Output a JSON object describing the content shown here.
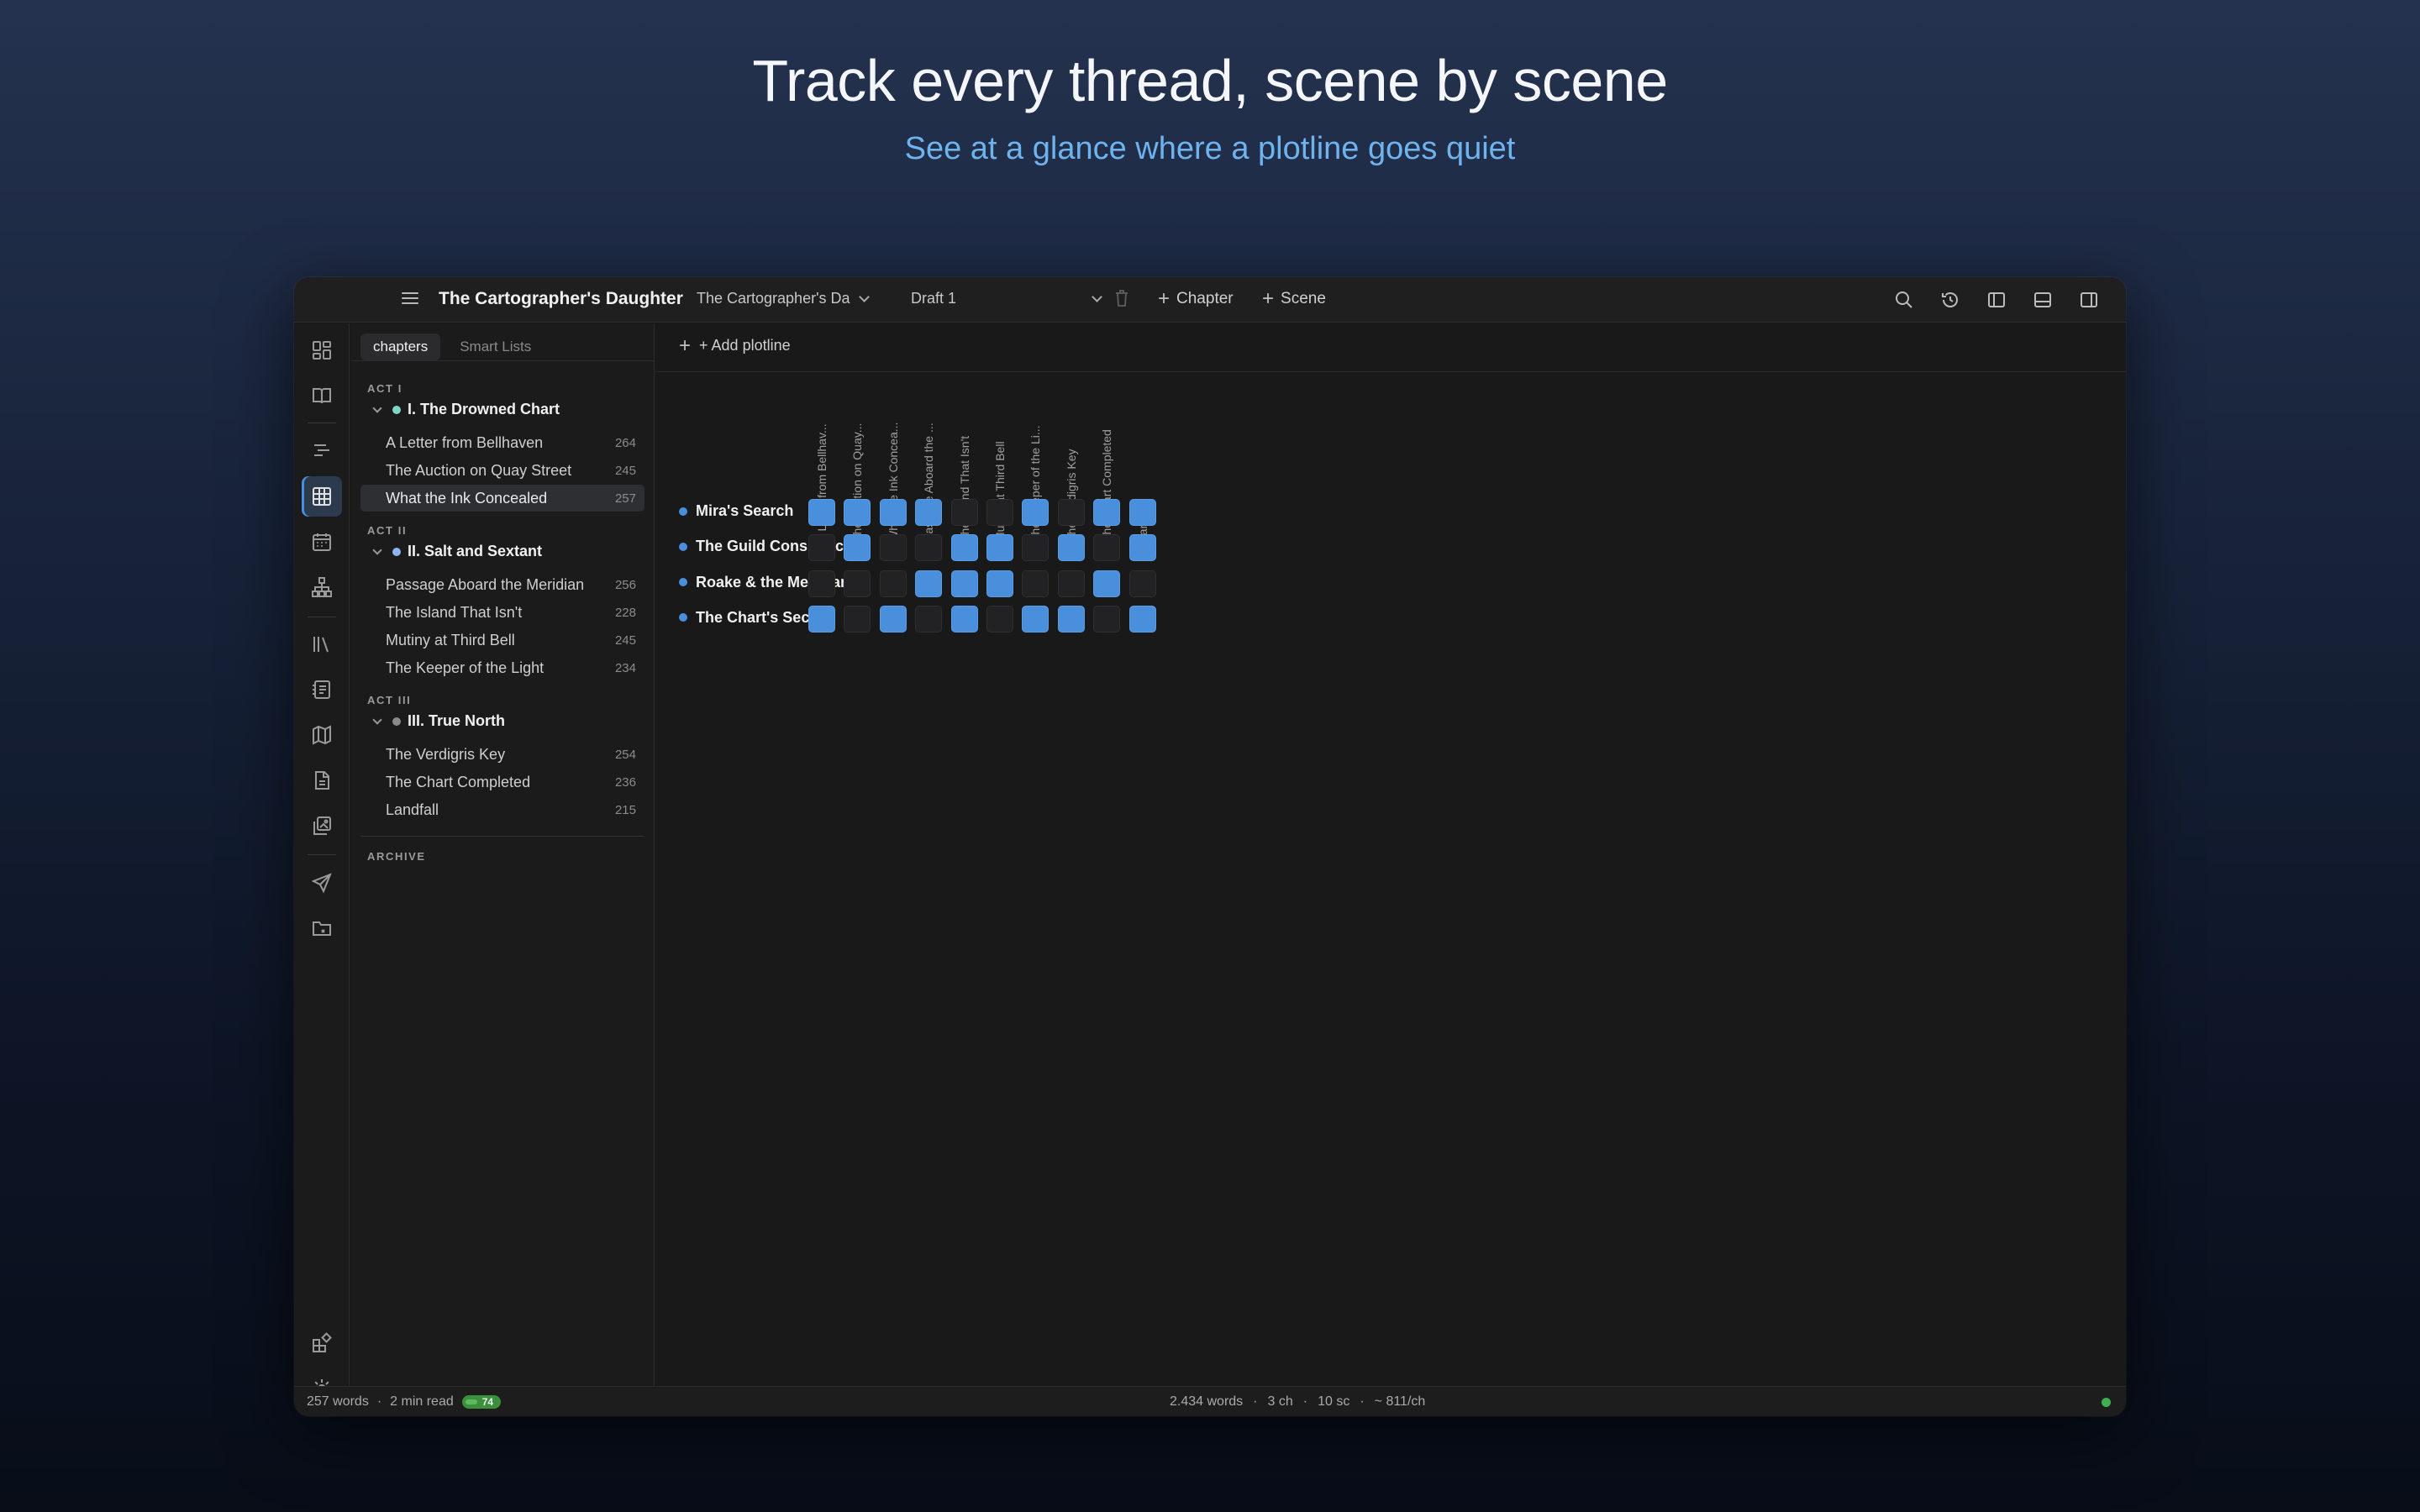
{
  "hero": {
    "title": "Track every thread, scene by scene",
    "subtitle": "See at a glance where a plotline goes quiet"
  },
  "titlebar": {
    "project_title": "The Cartographer's Daughter",
    "book_select": "The Cartographer's Da",
    "draft_select": "Draft 1",
    "add_chapter": "Chapter",
    "add_scene": "Scene",
    "icons": [
      "search-icon",
      "history-icon",
      "left-panel-icon",
      "bottom-panel-icon",
      "right-panel-icon"
    ]
  },
  "activity_bar": {
    "icons": [
      "dashboard-icon",
      "book-icon",
      "outline-icon",
      "grid-icon",
      "calendar-icon",
      "hierarchy-icon",
      "library-icon",
      "notes-icon",
      "map-icon",
      "document-icon",
      "gallery-icon",
      "send-icon",
      "folder-link-icon",
      "plugins-icon",
      "settings-icon"
    ],
    "active": "grid-icon"
  },
  "sidebar": {
    "tabs": [
      "chapters",
      "Smart Lists"
    ],
    "acts": [
      {
        "label": "ACT I",
        "chapter": "I. The Drowned Chart",
        "dot_color": "#7fd6c8",
        "scenes": [
          {
            "title": "A Letter from Bellhaven",
            "words": "264"
          },
          {
            "title": "The Auction on Quay Street",
            "words": "245"
          },
          {
            "title": "What the Ink Concealed",
            "words": "257"
          }
        ]
      },
      {
        "label": "ACT II",
        "chapter": "II. Salt and Sextant",
        "dot_color": "#8fb4f0",
        "scenes": [
          {
            "title": "Passage Aboard the Meridian",
            "words": "256"
          },
          {
            "title": "The Island That Isn't",
            "words": "228"
          },
          {
            "title": "Mutiny at Third Bell",
            "words": "245"
          },
          {
            "title": "The Keeper of the Light",
            "words": "234"
          }
        ]
      },
      {
        "label": "ACT III",
        "chapter": "III. True North",
        "dot_color": "#8a8a8a",
        "scenes": [
          {
            "title": "The Verdigris Key",
            "words": "254"
          },
          {
            "title": "The Chart Completed",
            "words": "236"
          },
          {
            "title": "Landfall",
            "words": "215"
          }
        ]
      }
    ],
    "active_scene": "What the Ink Concealed",
    "archive_label": "ARCHIVE"
  },
  "main": {
    "add_plotline": "+ Add plotline",
    "columns": [
      "A Letter from Bellhav...",
      "The Auction on Quay...",
      "What the Ink Concea...",
      "Passage Aboard the ...",
      "The Island That Isn't",
      "Mutiny at Third Bell",
      "The Keeper of the Li...",
      "The Verdigris Key",
      "The Chart Completed",
      "Landfall"
    ],
    "plotlines": [
      {
        "name": "Mira's Search",
        "color": "#4a8fdc",
        "cells": [
          1,
          1,
          1,
          1,
          0,
          0,
          1,
          0,
          1,
          1
        ]
      },
      {
        "name": "The Guild Conspiracy",
        "color": "#4a8fdc",
        "cells": [
          0,
          1,
          0,
          0,
          1,
          1,
          0,
          1,
          0,
          1
        ]
      },
      {
        "name": "Roake & the Meridian",
        "color": "#4a8fdc",
        "cells": [
          0,
          0,
          0,
          1,
          1,
          1,
          0,
          0,
          1,
          0
        ]
      },
      {
        "name": "The Chart's Secret",
        "color": "#4a8fdc",
        "cells": [
          1,
          0,
          1,
          0,
          1,
          0,
          1,
          1,
          0,
          1
        ]
      }
    ]
  },
  "status": {
    "words": "257 words",
    "read_time": "2 min read",
    "badge": "74",
    "total_words": "2.434 words",
    "chapters": "3 ch",
    "scenes": "10 sc",
    "per_chapter": "~ 811/ch",
    "sep": "·"
  }
}
